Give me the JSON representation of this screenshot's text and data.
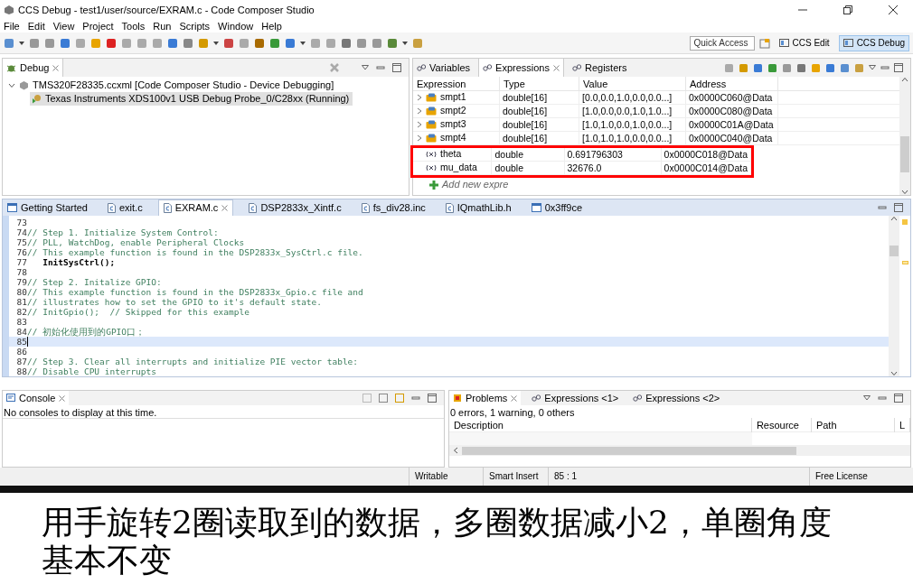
{
  "window": {
    "title": "CCS Debug - test1/user/source/EXRAM.c - Code Composer Studio"
  },
  "menu": [
    "File",
    "Edit",
    "View",
    "Project",
    "Tools",
    "Run",
    "Scripts",
    "Window",
    "Help"
  ],
  "toolbar": {
    "quick_access": {
      "placeholder": "Quick Access"
    },
    "perspectives": [
      {
        "label": "CCS Edit",
        "selected": false
      },
      {
        "label": "CCS Debug",
        "selected": true
      }
    ]
  },
  "debug_view": {
    "tab": "Debug",
    "tree": [
      {
        "label": "TMS320F28335.ccxml [Code Composer Studio - Device Debugging]",
        "expanded": true,
        "children": [
          {
            "label": "Texas Instruments XDS100v1 USB Debug Probe_0/C28xx (Running)",
            "selected": true
          }
        ]
      }
    ]
  },
  "expressions_view": {
    "tabs": [
      {
        "label": "Variables",
        "selected": false
      },
      {
        "label": "Expressions",
        "selected": true
      },
      {
        "label": "Registers",
        "selected": false
      }
    ],
    "columns": [
      "Expression",
      "Type",
      "Value",
      "Address"
    ],
    "rows": [
      {
        "kind": "array",
        "expression": "smpt1",
        "type": "double[16]",
        "value": "[0.0,0.0,1.0,0.0,0.0...]",
        "address": "0x0000C060@Data",
        "boxed": false
      },
      {
        "kind": "array",
        "expression": "smpt2",
        "type": "double[16]",
        "value": "[1.0,0.0,0.0,1.0,1.0...]",
        "address": "0x0000C080@Data",
        "boxed": false
      },
      {
        "kind": "array",
        "expression": "smpt3",
        "type": "double[16]",
        "value": "[1.0,1.0,0.0,1.0,0.0...]",
        "address": "0x0000C01A@Data",
        "boxed": false
      },
      {
        "kind": "array",
        "expression": "smpt4",
        "type": "double[16]",
        "value": "[1.0,1.0,1.0,0.0,0.0...]",
        "address": "0x0000C040@Data",
        "boxed": false
      },
      {
        "kind": "scalar",
        "expression": "theta",
        "type": "double",
        "value": "0.691796303",
        "address": "0x0000C018@Data",
        "boxed": true
      },
      {
        "kind": "scalar",
        "expression": "mu_data",
        "type": "double",
        "value": "32676.0",
        "address": "0x0000C014@Data",
        "boxed": true
      }
    ],
    "add_row": "Add new expre"
  },
  "editor": {
    "tabs": [
      {
        "label": "Getting Started",
        "kind": "page",
        "selected": false
      },
      {
        "label": "exit.c",
        "kind": "c",
        "selected": false
      },
      {
        "label": "EXRAM.c",
        "kind": "c",
        "selected": true
      },
      {
        "label": "DSP2833x_Xintf.c",
        "kind": "c",
        "selected": false
      },
      {
        "label": "fs_div28.inc",
        "kind": "c",
        "selected": false
      },
      {
        "label": "IQmathLib.h",
        "kind": "c",
        "selected": false
      },
      {
        "label": "0x3ff9ce",
        "kind": "page",
        "selected": false
      }
    ],
    "lines": [
      {
        "number": "73",
        "kind": "blank",
        "current": false
      },
      {
        "number": "74",
        "kind": "comment",
        "text": "// Step 1. Initialize System Control:",
        "current": false
      },
      {
        "number": "75",
        "kind": "comment",
        "text": "// PLL, WatchDog, enable Peripheral Clocks",
        "current": false
      },
      {
        "number": "76",
        "kind": "comment",
        "text": "// This example function is found in the DSP2833x_SysCtrl.c file.",
        "current": false
      },
      {
        "number": "77",
        "kind": "code",
        "text": "   InitSysCtrl();",
        "current": false
      },
      {
        "number": "78",
        "kind": "blank",
        "current": false
      },
      {
        "number": "79",
        "kind": "comment",
        "text": "// Step 2. Initalize GPIO:",
        "current": false
      },
      {
        "number": "80",
        "kind": "comment",
        "text": "// This example function is found in the DSP2833x_Gpio.c file and",
        "current": false
      },
      {
        "number": "81",
        "kind": "comment",
        "text": "// illustrates how to set the GPIO to it's default state.",
        "current": false
      },
      {
        "number": "82",
        "kind": "comment",
        "text": "// InitGpio();  // Skipped for this example",
        "current": false
      },
      {
        "number": "83",
        "kind": "blank",
        "current": false
      },
      {
        "number": "84",
        "kind": "comment",
        "text": "// 初始化使用到的GPIO口；",
        "current": false
      },
      {
        "number": "85",
        "kind": "blank",
        "current": true
      },
      {
        "number": "86",
        "kind": "blank",
        "current": false
      },
      {
        "number": "87",
        "kind": "comment",
        "text": "// Step 3. Clear all interrupts and initialize PIE vector table:",
        "current": false
      },
      {
        "number": "88",
        "kind": "comment",
        "text": "// Disable CPU interrupts",
        "current": false
      }
    ]
  },
  "console": {
    "tab": "Console",
    "message": "No consoles to display at this time."
  },
  "problems": {
    "tabs": [
      {
        "label": "Problems",
        "selected": true
      },
      {
        "label": "Expressions <1>",
        "selected": false
      },
      {
        "label": "Expressions <2>",
        "selected": false
      }
    ],
    "summary": "0 errors, 1 warning, 0 others",
    "columns": [
      "Description",
      "Resource",
      "Path",
      "L"
    ]
  },
  "status_bar": [
    "Writable",
    "Smart Insert",
    "85 : 1",
    "Free License"
  ],
  "caption": "用手旋转2圈读取到的数据，多圈数据减小2，单圈角度基本不变"
}
